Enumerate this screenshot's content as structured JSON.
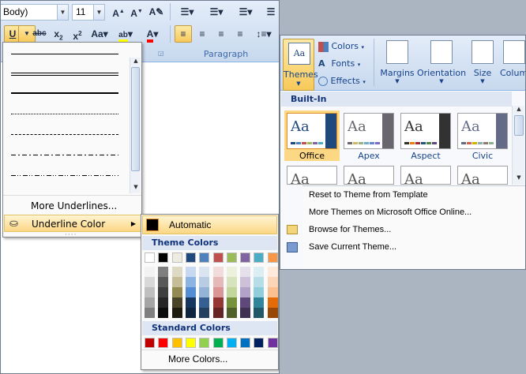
{
  "font": {
    "name_value": "Body)",
    "size_value": "11"
  },
  "ribbon": {
    "paragraph_group_label": "Paragraph",
    "change_case_label": "Aa"
  },
  "underline_menu": {
    "more_underlines": "More Underlines...",
    "underline_color": "Underline Color"
  },
  "underline_color_menu": {
    "automatic": "Automatic",
    "theme_colors_header": "Theme Colors",
    "standard_colors_header": "Standard Colors",
    "more_colors": "More Colors...",
    "theme_colors": [
      "#ffffff",
      "#000000",
      "#eeece1",
      "#1f497d",
      "#4f81bd",
      "#c0504d",
      "#9bbb59",
      "#8064a2",
      "#4bacc6",
      "#f79646"
    ],
    "theme_shades": [
      [
        "#f2f2f2",
        "#d8d8d8",
        "#bfbfbf",
        "#a5a5a5",
        "#7f7f7f"
      ],
      [
        "#7f7f7f",
        "#595959",
        "#3f3f3f",
        "#262626",
        "#0c0c0c"
      ],
      [
        "#ddd9c3",
        "#c4bd97",
        "#938953",
        "#494429",
        "#1d1b10"
      ],
      [
        "#c6d9f0",
        "#8db3e2",
        "#548dd4",
        "#17365d",
        "#0f243e"
      ],
      [
        "#dbe5f1",
        "#b8cce4",
        "#95b3d7",
        "#366092",
        "#244061"
      ],
      [
        "#f2dcdb",
        "#e5b9b7",
        "#d99694",
        "#953734",
        "#632423"
      ],
      [
        "#ebf1dd",
        "#d7e3bc",
        "#c3d69b",
        "#76923c",
        "#4f6128"
      ],
      [
        "#e5e0ec",
        "#ccc1d9",
        "#b2a2c7",
        "#5f497a",
        "#3f3151"
      ],
      [
        "#dbeef3",
        "#b7dde8",
        "#92cddc",
        "#31859b",
        "#205867"
      ],
      [
        "#fdeada",
        "#fbd5b5",
        "#fac08f",
        "#e36c09",
        "#974806"
      ]
    ],
    "standard_colors": [
      "#c00000",
      "#ff0000",
      "#ffc000",
      "#ffff00",
      "#92d050",
      "#00b050",
      "#00b0f0",
      "#0070c0",
      "#002060",
      "#7030a0"
    ]
  },
  "page_setup_ribbon": {
    "themes_label": "Themes",
    "colors_label": "Colors",
    "fonts_label": "Fonts",
    "effects_label": "Effects",
    "margins_label": "Margins",
    "orientation_label": "Orientation",
    "size_label": "Size",
    "columns_label": "Colum"
  },
  "themes_menu": {
    "builtin_header": "Built-In",
    "themes": [
      {
        "name": "Office",
        "colors": [
          "#1f497d",
          "#4f81bd",
          "#c0504d",
          "#9bbb59",
          "#8064a2",
          "#4bacc6"
        ]
      },
      {
        "name": "Apex",
        "colors": [
          "#69676d",
          "#ceb966",
          "#9cb084",
          "#6bb1c9",
          "#6585cf",
          "#7e6bc9"
        ]
      },
      {
        "name": "Aspect",
        "colors": [
          "#323232",
          "#f07f09",
          "#9f2936",
          "#1b587c",
          "#4e8542",
          "#604878"
        ]
      },
      {
        "name": "Civic",
        "colors": [
          "#646b86",
          "#d16349",
          "#ccb400",
          "#8cadae",
          "#8c7b70",
          "#8fb08c"
        ]
      }
    ],
    "reset_theme": "Reset to Theme from Template",
    "more_themes": "More Themes on Microsoft Office Online...",
    "browse_themes": "Browse for Themes...",
    "save_theme": "Save Current Theme..."
  }
}
